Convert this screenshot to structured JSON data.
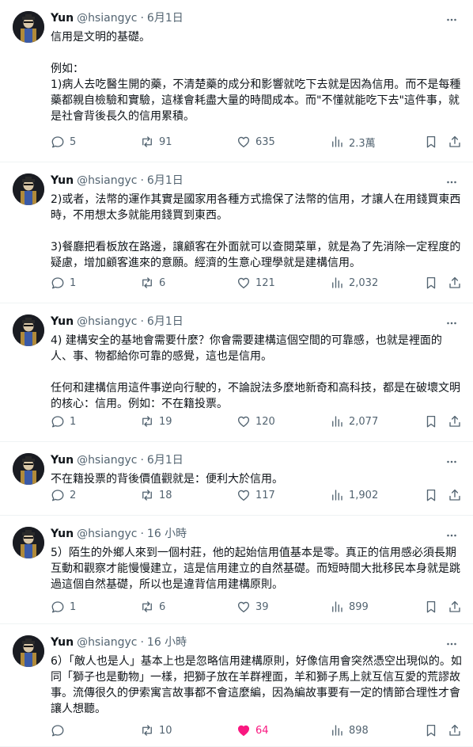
{
  "author": {
    "name": "Yun",
    "handle": "@hsiangyc"
  },
  "tweets": [
    {
      "time": "6月1日",
      "paragraphs": [
        "信用是文明的基礎。",
        "",
        "例如：",
        "1)病人去吃醫生開的藥，不清楚藥的成分和影響就吃下去就是因為信用。而不是每種藥都親自檢驗和實驗，這樣會耗盡大量的時間成本。而\"不懂就能吃下去\"這件事，就是社會背後長久的信用累積。"
      ],
      "replies": "5",
      "retweets": "91",
      "likes": "635",
      "views": "2.3萬",
      "liked": false
    },
    {
      "time": "6月1日",
      "paragraphs": [
        "2)或者，法幣的運作其實是國家用各種方式擔保了法幣的信用，才讓人在用錢買東西時，不用想太多就能用錢買到東西。",
        "",
        "3)餐廳把看板放在路邊，讓顧客在外面就可以查閱菜單，就是為了先消除一定程度的疑慮，增加顧客進來的意願。經濟的生意心理學就是建構信用。"
      ],
      "replies": "1",
      "retweets": "6",
      "likes": "121",
      "views": "2,032",
      "liked": false
    },
    {
      "time": "6月1日",
      "paragraphs": [
        "4) 建構安全的基地會需要什麼？你會需要建構這個空間的可靠感，也就是裡面的人、事、物都給你可靠的感覺，這也是信用。",
        "",
        "任何和建構信用這件事逆向行駛的，不論說法多麼地新奇和高科技，都是在破壞文明的核心：信用。例如：不在籍投票。"
      ],
      "replies": "1",
      "retweets": "19",
      "likes": "120",
      "views": "2,077",
      "liked": false
    },
    {
      "time": "6月1日",
      "paragraphs": [
        "不在籍投票的背後價值觀就是：便利大於信用。"
      ],
      "replies": "2",
      "retweets": "18",
      "likes": "117",
      "views": "1,902",
      "liked": false
    },
    {
      "time": "16 小時",
      "paragraphs": [
        "5）陌生的外鄉人來到一個村莊，他的起始信用值基本是零。真正的信用感必須長期互動和觀察才能慢慢建立，這是信用建立的自然基礎。而短時間大批移民本身就是跳過這個自然基礎，所以也是違背信用建構原則。"
      ],
      "replies": "1",
      "retweets": "6",
      "likes": "39",
      "views": "899",
      "liked": false
    },
    {
      "time": "16 小時",
      "paragraphs": [
        "6）「敵人也是人」基本上也是忽略信用建構原則，好像信用會突然憑空出現似的。如同「獅子也是動物」一樣，把獅子放在羊群裡面，羊和獅子馬上就互信互愛的荒謬故事。流傳很久的伊索寓言故事都不會這麼編，因為編故事要有一定的情節合理性才會讓人想聽。"
      ],
      "replies": "",
      "retweets": "10",
      "likes": "64",
      "views": "898",
      "liked": true
    }
  ],
  "icons": {
    "reply": "reply-bubble-icon",
    "retweet": "retweet-arrows-icon",
    "like": "heart-icon",
    "views": "bar-chart-icon",
    "bookmark": "bookmark-icon",
    "share": "share-upload-icon",
    "more": "more-dots-icon"
  },
  "colors": {
    "text": "#0f1419",
    "secondary": "#536471",
    "like_active": "#f91880",
    "divider": "#eff3f4"
  }
}
